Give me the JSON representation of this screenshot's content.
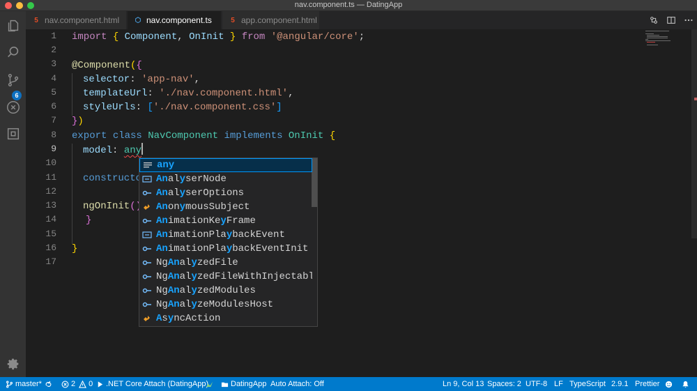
{
  "window": {
    "title": "nav.component.ts — DatingApp"
  },
  "activity": {
    "scm_badge": "6"
  },
  "tabs": [
    {
      "label": "nav.component.html",
      "icon": "html-file-icon",
      "active": false
    },
    {
      "label": "nav.component.ts",
      "icon": "angular-file-icon",
      "active": true
    },
    {
      "label": "app.component.html",
      "icon": "html-file-icon",
      "active": false
    }
  ],
  "editor": {
    "line_numbers": [
      "1",
      "2",
      "3",
      "4",
      "5",
      "6",
      "7",
      "8",
      "9",
      "10",
      "11",
      "12",
      "13",
      "14",
      "15",
      "16",
      "17"
    ],
    "current_line": 9,
    "lines": {
      "l1": {
        "a": "import ",
        "b": "{ ",
        "c": "Component",
        "d": ", ",
        "e": "OnInit",
        "f": " }",
        "g": " from ",
        "h": "'@angular/core'",
        "i": ";"
      },
      "l3": {
        "a": "@Component",
        "b": "(",
        "c": "{"
      },
      "l4": {
        "a": "selector",
        "b": ": ",
        "c": "'app-nav'",
        "d": ","
      },
      "l5": {
        "a": "templateUrl",
        "b": ": ",
        "c": "'./nav.component.html'",
        "d": ","
      },
      "l6": {
        "a": "styleUrls",
        "b": ": ",
        "c": "[",
        "d": "'./nav.component.css'",
        "e": "]"
      },
      "l7": {
        "a": "}",
        "b": ")"
      },
      "l8": {
        "a": "export",
        "b": " class ",
        "c": "NavComponent",
        "d": " implements ",
        "e": "OnInit",
        "f": " {"
      },
      "l9": {
        "a": "model",
        "b": ": ",
        "c": "any"
      },
      "l11": {
        "a": "constructo"
      },
      "l13": {
        "a": "ngOnInit",
        "b": "()"
      },
      "l14": {
        "a": "}"
      },
      "l16": {
        "a": "}"
      }
    }
  },
  "suggestions": [
    {
      "hl": "any",
      "rest": "",
      "icon": "keyword-icon",
      "selected": true
    },
    {
      "hl": "An",
      "mid": "al",
      "hl2": "y",
      "rest": "serNode",
      "icon": "interface-icon"
    },
    {
      "hl": "An",
      "mid": "al",
      "hl2": "y",
      "rest": "serOptions",
      "icon": "reference-icon"
    },
    {
      "hl": "An",
      "mid": "on",
      "hl2": "y",
      "rest": "mousSubject",
      "icon": "class-icon"
    },
    {
      "hl": "An",
      "mid": "imationKe",
      "hl2": "y",
      "rest": "Frame",
      "icon": "reference-icon"
    },
    {
      "hl": "An",
      "mid": "imationPla",
      "hl2": "y",
      "rest": "backEvent",
      "icon": "interface-icon"
    },
    {
      "hl": "An",
      "mid": "imationPla",
      "hl2": "y",
      "rest": "backEventInit",
      "icon": "reference-icon"
    },
    {
      "pre": "Ng",
      "hl": "An",
      "mid": "al",
      "hl2": "y",
      "rest": "zedFile",
      "icon": "reference-icon"
    },
    {
      "pre": "Ng",
      "hl": "An",
      "mid": "al",
      "hl2": "y",
      "rest": "zedFileWithInjectables",
      "icon": "reference-icon"
    },
    {
      "pre": "Ng",
      "hl": "An",
      "mid": "al",
      "hl2": "y",
      "rest": "zedModules",
      "icon": "reference-icon"
    },
    {
      "pre": "Ng",
      "hl": "An",
      "mid": "al",
      "hl2": "y",
      "rest": "zeModulesHost",
      "icon": "reference-icon"
    },
    {
      "hl": "A",
      "mid": "s",
      "hl2": "y",
      "rest": "ncAction",
      "icon": "class-icon"
    }
  ],
  "status": {
    "branch": "master*",
    "errors": "2",
    "warnings": "0",
    "debug": ".NET Core Attach (DatingApp)",
    "folder": "DatingApp",
    "auto_attach": "Auto Attach: Off",
    "position": "Ln 9, Col 13",
    "spaces": "Spaces: 2",
    "encoding": "UTF-8",
    "eol": "LF",
    "language": "TypeScript",
    "version": "2.9.1",
    "formatter": "Prettier"
  },
  "colors": {
    "accent": "#007acc",
    "selected_border": "#0097fb",
    "match": "#18a3ff"
  }
}
